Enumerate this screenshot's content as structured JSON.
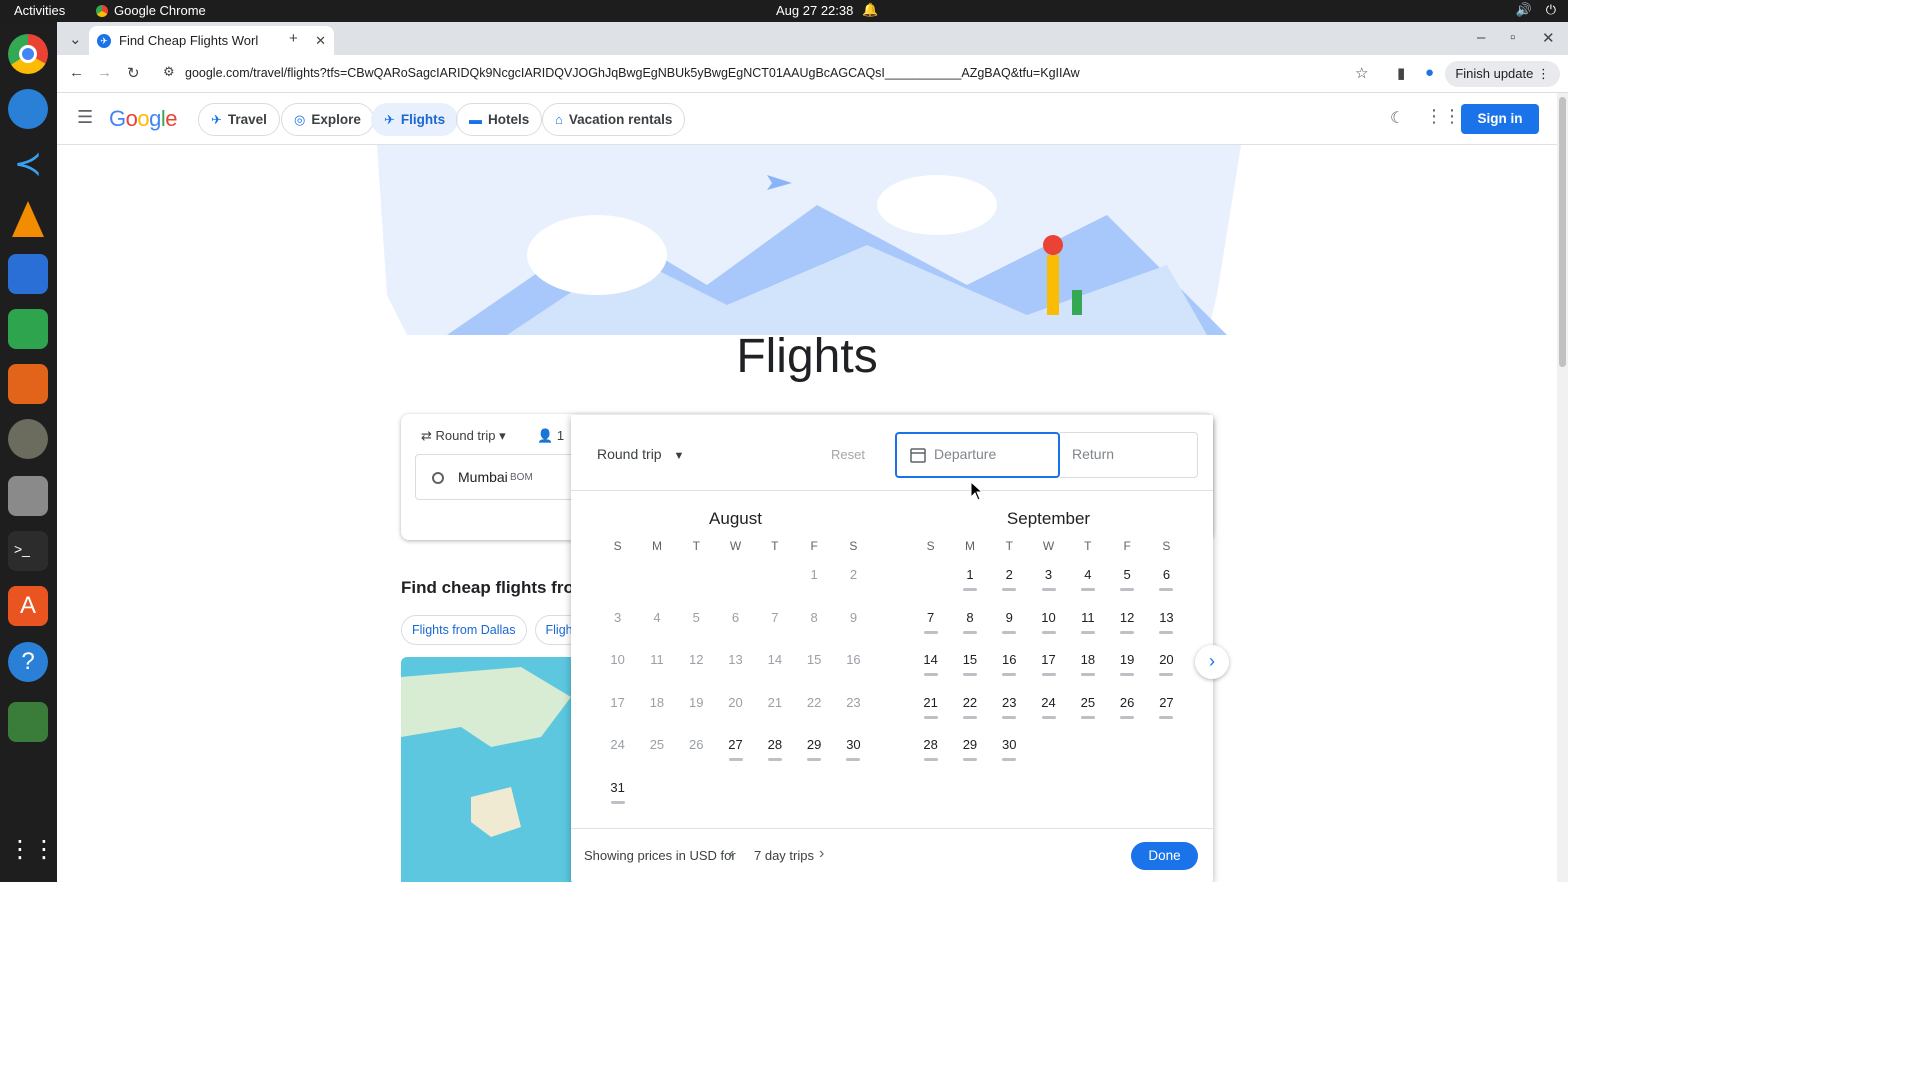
{
  "system": {
    "activities": "Activities",
    "app_name": "Google Chrome",
    "clock": "Aug 27  22:38"
  },
  "browser": {
    "tab_title": "Find Cheap Flights Worl",
    "url": "google.com/travel/flights?tfs=CBwQARoSagcIARIDQk9NcgcIARIDQVJOGhJqBwgEgNBUk5yBwgEgNCT01AAUgBcAGCAQsI___________AZgBAQ&tfu=KgIIAw",
    "finish_update": "Finish update"
  },
  "nav": {
    "logo": "Google",
    "items": [
      {
        "label": "Travel",
        "icon": "travel-icon"
      },
      {
        "label": "Explore",
        "icon": "explore-icon"
      },
      {
        "label": "Flights",
        "icon": "flight-icon"
      },
      {
        "label": "Hotels",
        "icon": "hotel-icon"
      },
      {
        "label": "Vacation rentals",
        "icon": "house-icon"
      }
    ],
    "sign_in": "Sign in"
  },
  "page": {
    "title": "Flights",
    "find_cheap": "Find cheap flights from",
    "chips": [
      "Flights from Dallas",
      "Fligh"
    ],
    "search": {
      "trip_type": "Round trip",
      "passengers": "1",
      "origin": "Mumbai",
      "origin_code": "BOM"
    }
  },
  "calendar": {
    "trip_type": "Round trip",
    "reset": "Reset",
    "departure_placeholder": "Departure",
    "return_placeholder": "Return",
    "weekdays": [
      "S",
      "M",
      "T",
      "W",
      "T",
      "F",
      "S"
    ],
    "months": [
      {
        "name": "August",
        "offset": 5,
        "days": 31,
        "past_until": 26
      },
      {
        "name": "September",
        "offset": 1,
        "days": 30,
        "past_until": 0
      }
    ],
    "footer": {
      "showing": "Showing prices in USD for",
      "trip_length": "7 day trips",
      "done": "Done"
    }
  }
}
